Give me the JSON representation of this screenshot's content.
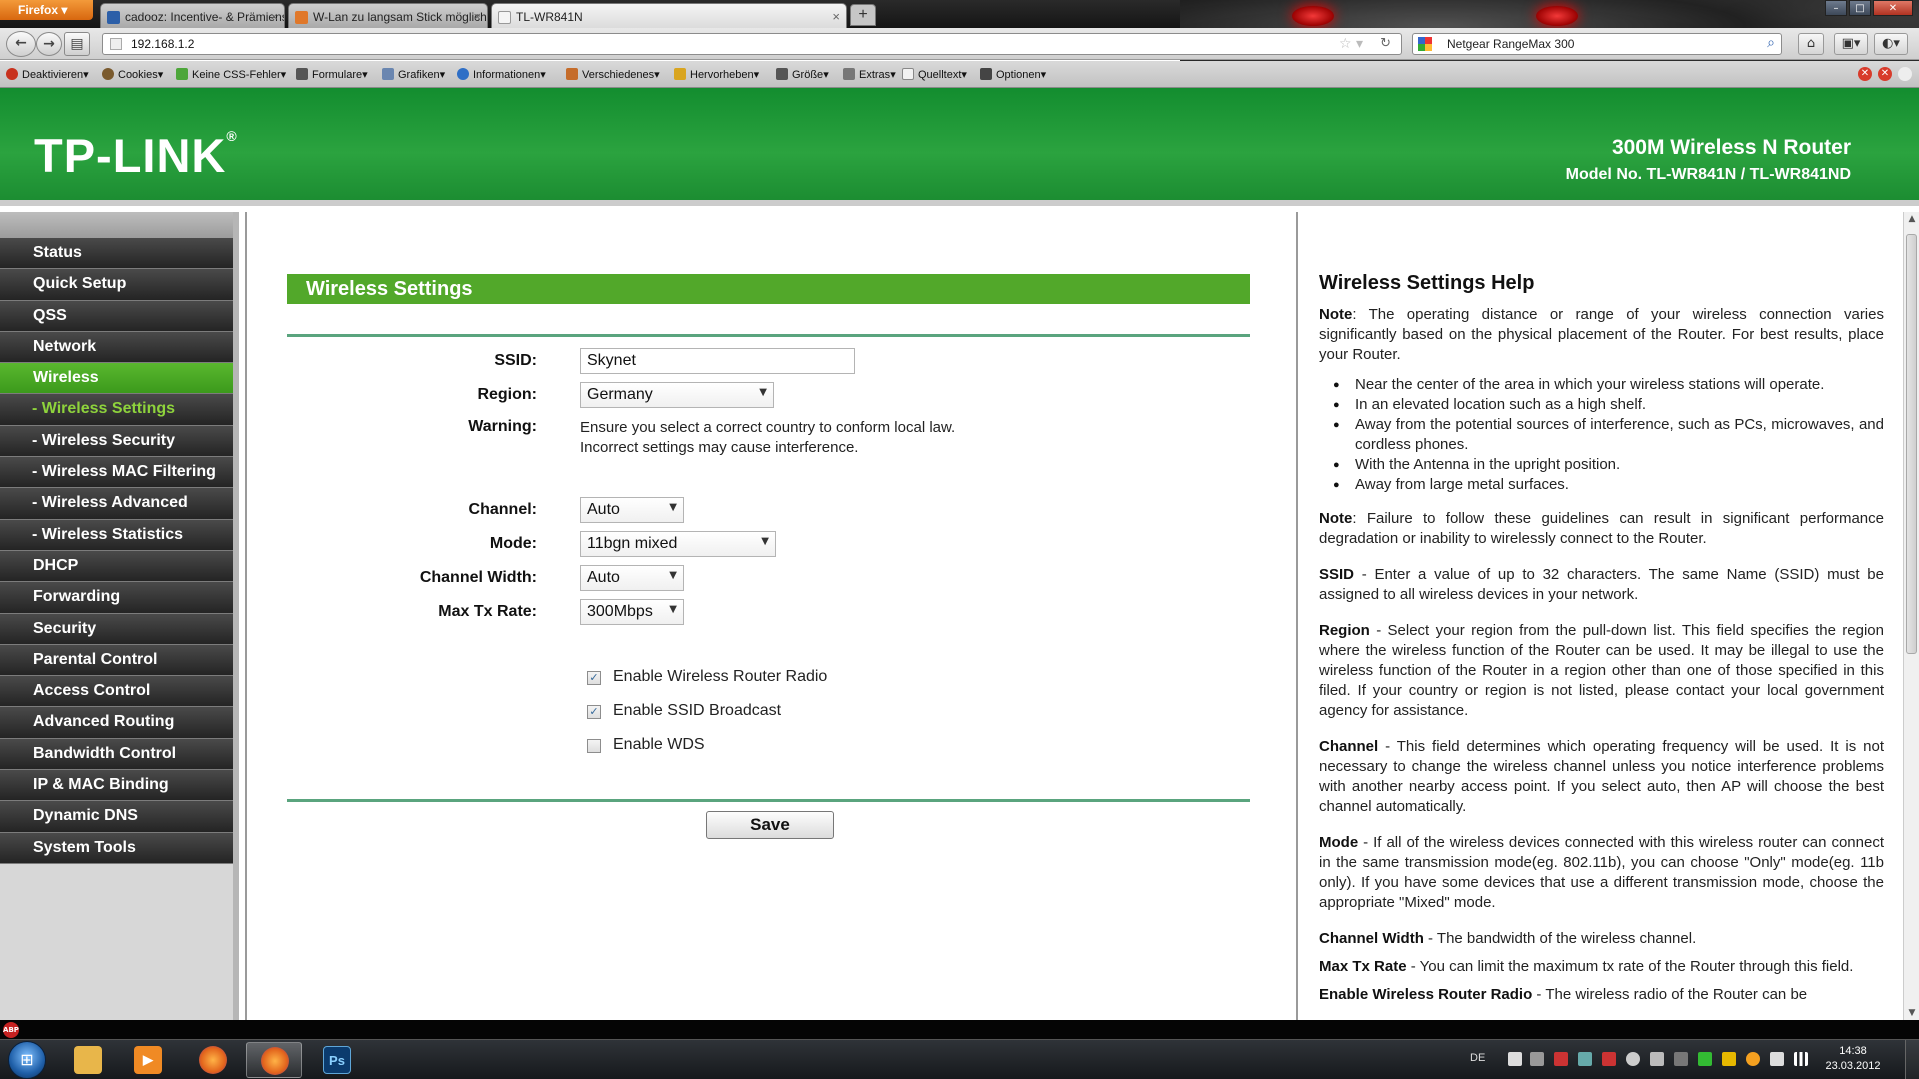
{
  "browser": {
    "menu_button": "Firefox",
    "tabs": [
      {
        "title": "cadooz: Incentive- & Prämiensysteme ...",
        "icon_color": "#2c5fa8"
      },
      {
        "title": "W-Lan zu langsam Stick möglicherwe...",
        "icon_color": "#e0782a"
      },
      {
        "title": "TL-WR841N",
        "icon_color": "#f5f5f5"
      }
    ],
    "new_tab": "+",
    "url": "192.168.1.2",
    "search": "Netgear RangeMax 300",
    "win_controls": {
      "minimize": "–",
      "maximize": "□",
      "close": "✕"
    }
  },
  "devbar": {
    "items": [
      {
        "label": "Deaktivieren",
        "icon_color": "#c8321e"
      },
      {
        "label": "Cookies",
        "icon_color": "#7a5a2e"
      },
      {
        "label": "Keine CSS-Fehler",
        "icon_color": "#4da63a"
      },
      {
        "label": "Formulare",
        "icon_color": "#555555"
      },
      {
        "label": "Grafiken",
        "icon_color": "#6a86b0"
      },
      {
        "label": "Informationen",
        "icon_color": "#2f6fc6"
      },
      {
        "label": "Verschiedenes",
        "icon_color": "#c56c2a"
      },
      {
        "label": "Hervorheben",
        "icon_color": "#d9a520"
      },
      {
        "label": "Größe",
        "icon_color": "#555555"
      },
      {
        "label": "Extras",
        "icon_color": "#777777"
      },
      {
        "label": "Quelltext",
        "icon_color": "#f2f2f2"
      },
      {
        "label": "Optionen",
        "icon_color": "#444444"
      }
    ]
  },
  "header": {
    "logo": "TP-LINK",
    "logo_mark": "®",
    "product": "300M Wireless N Router",
    "model": "Model No. TL-WR841N / TL-WR841ND"
  },
  "menu": [
    {
      "label": "Status",
      "state": "normal"
    },
    {
      "label": "Quick Setup",
      "state": "normal"
    },
    {
      "label": "QSS",
      "state": "normal"
    },
    {
      "label": "Network",
      "state": "normal"
    },
    {
      "label": "Wireless",
      "state": "active"
    },
    {
      "label": "- Wireless Settings",
      "state": "sub-active"
    },
    {
      "label": "- Wireless Security",
      "state": "sub"
    },
    {
      "label": "- Wireless MAC Filtering",
      "state": "sub"
    },
    {
      "label": "- Wireless Advanced",
      "state": "sub"
    },
    {
      "label": "- Wireless Statistics",
      "state": "sub"
    },
    {
      "label": "DHCP",
      "state": "normal"
    },
    {
      "label": "Forwarding",
      "state": "normal"
    },
    {
      "label": "Security",
      "state": "normal"
    },
    {
      "label": "Parental Control",
      "state": "normal"
    },
    {
      "label": "Access Control",
      "state": "normal"
    },
    {
      "label": "Advanced Routing",
      "state": "normal"
    },
    {
      "label": "Bandwidth Control",
      "state": "normal"
    },
    {
      "label": "IP & MAC Binding",
      "state": "normal"
    },
    {
      "label": "Dynamic DNS",
      "state": "normal"
    },
    {
      "label": "System Tools",
      "state": "normal"
    }
  ],
  "form": {
    "title": "Wireless Settings",
    "ssid_label": "SSID:",
    "ssid_value": "Skynet",
    "region_label": "Region:",
    "region_value": "Germany",
    "warning_label": "Warning:",
    "warning_line1": "Ensure you select a correct country to conform local law.",
    "warning_line2": "Incorrect settings may cause interference.",
    "channel_label": "Channel:",
    "channel_value": "Auto",
    "mode_label": "Mode:",
    "mode_value": "11bgn mixed",
    "width_label": "Channel Width:",
    "width_value": "Auto",
    "rate_label": "Max Tx Rate:",
    "rate_value": "300Mbps",
    "checkboxes": [
      {
        "label": "Enable Wireless Router Radio",
        "checked": true
      },
      {
        "label": "Enable SSID Broadcast",
        "checked": true
      },
      {
        "label": "Enable WDS",
        "checked": false
      }
    ],
    "save_label": "Save"
  },
  "help": {
    "title": "Wireless Settings Help",
    "note1_term": "Note",
    "note1_text": ": The operating distance or range of your wireless connection varies significantly based on the physical placement of the Router. For best results, place your Router.",
    "bullets": [
      "Near the center of the area in which your wireless stations will operate.",
      "In an elevated location such as a high shelf.",
      "Away from the potential sources of interference, such as PCs, microwaves, and cordless phones.",
      "With the Antenna in the upright position.",
      "Away from large metal surfaces."
    ],
    "note2_term": "Note",
    "note2_text": ": Failure to follow these guidelines can result in significant performance degradation or inability to wirelessly connect to the Router.",
    "ssid_term": "SSID",
    "ssid_text": " - Enter a value of up to 32 characters. The same Name (SSID) must be assigned to all wireless devices in your network.",
    "region_term": "Region",
    "region_text": " - Select your region from the pull-down list. This field specifies the region where the wireless function of the Router can be used. It may be illegal to use the wireless function of the Router in a region other than one of those specified in this filed. If your country or region is not listed, please contact your local government agency for assistance.",
    "channel_term": "Channel",
    "channel_text": " - This field determines which operating frequency will be used. It is not necessary to change the wireless channel unless you notice interference problems with another nearby access point. If you select auto, then AP will choose the best channel automatically.",
    "mode_term": "Mode",
    "mode_text": " - If all of the wireless devices connected with this wireless router can connect in the same transmission mode(eg. 802.11b), you can choose \"Only\" mode(eg. 11b only). If you have some devices that use a different transmission mode, choose the appropriate \"Mixed\" mode.",
    "width_term": "Channel Width",
    "width_text": " - The bandwidth of the wireless channel.",
    "rate_term": "Max Tx Rate",
    "rate_text": " - You can limit the maximum tx rate of the Router through this field.",
    "radio_term": "Enable Wireless Router Radio",
    "radio_text": " - The wireless radio of the Router can be"
  },
  "statusbar": {
    "abp": "ABP"
  },
  "taskbar": {
    "apps": [
      {
        "name": "explorer",
        "label": "",
        "color": "#e8b64a"
      },
      {
        "name": "media-player",
        "label": "▶",
        "color": "#f08a24"
      },
      {
        "name": "firefox",
        "label": "",
        "color": "#e2641c"
      },
      {
        "name": "firefox-active",
        "label": "",
        "color": "#e2641c"
      },
      {
        "name": "photoshop",
        "label": "Ps",
        "color": "#0b3b6e"
      }
    ],
    "language": "DE",
    "time": "14:38",
    "date": "23.03.2012"
  }
}
